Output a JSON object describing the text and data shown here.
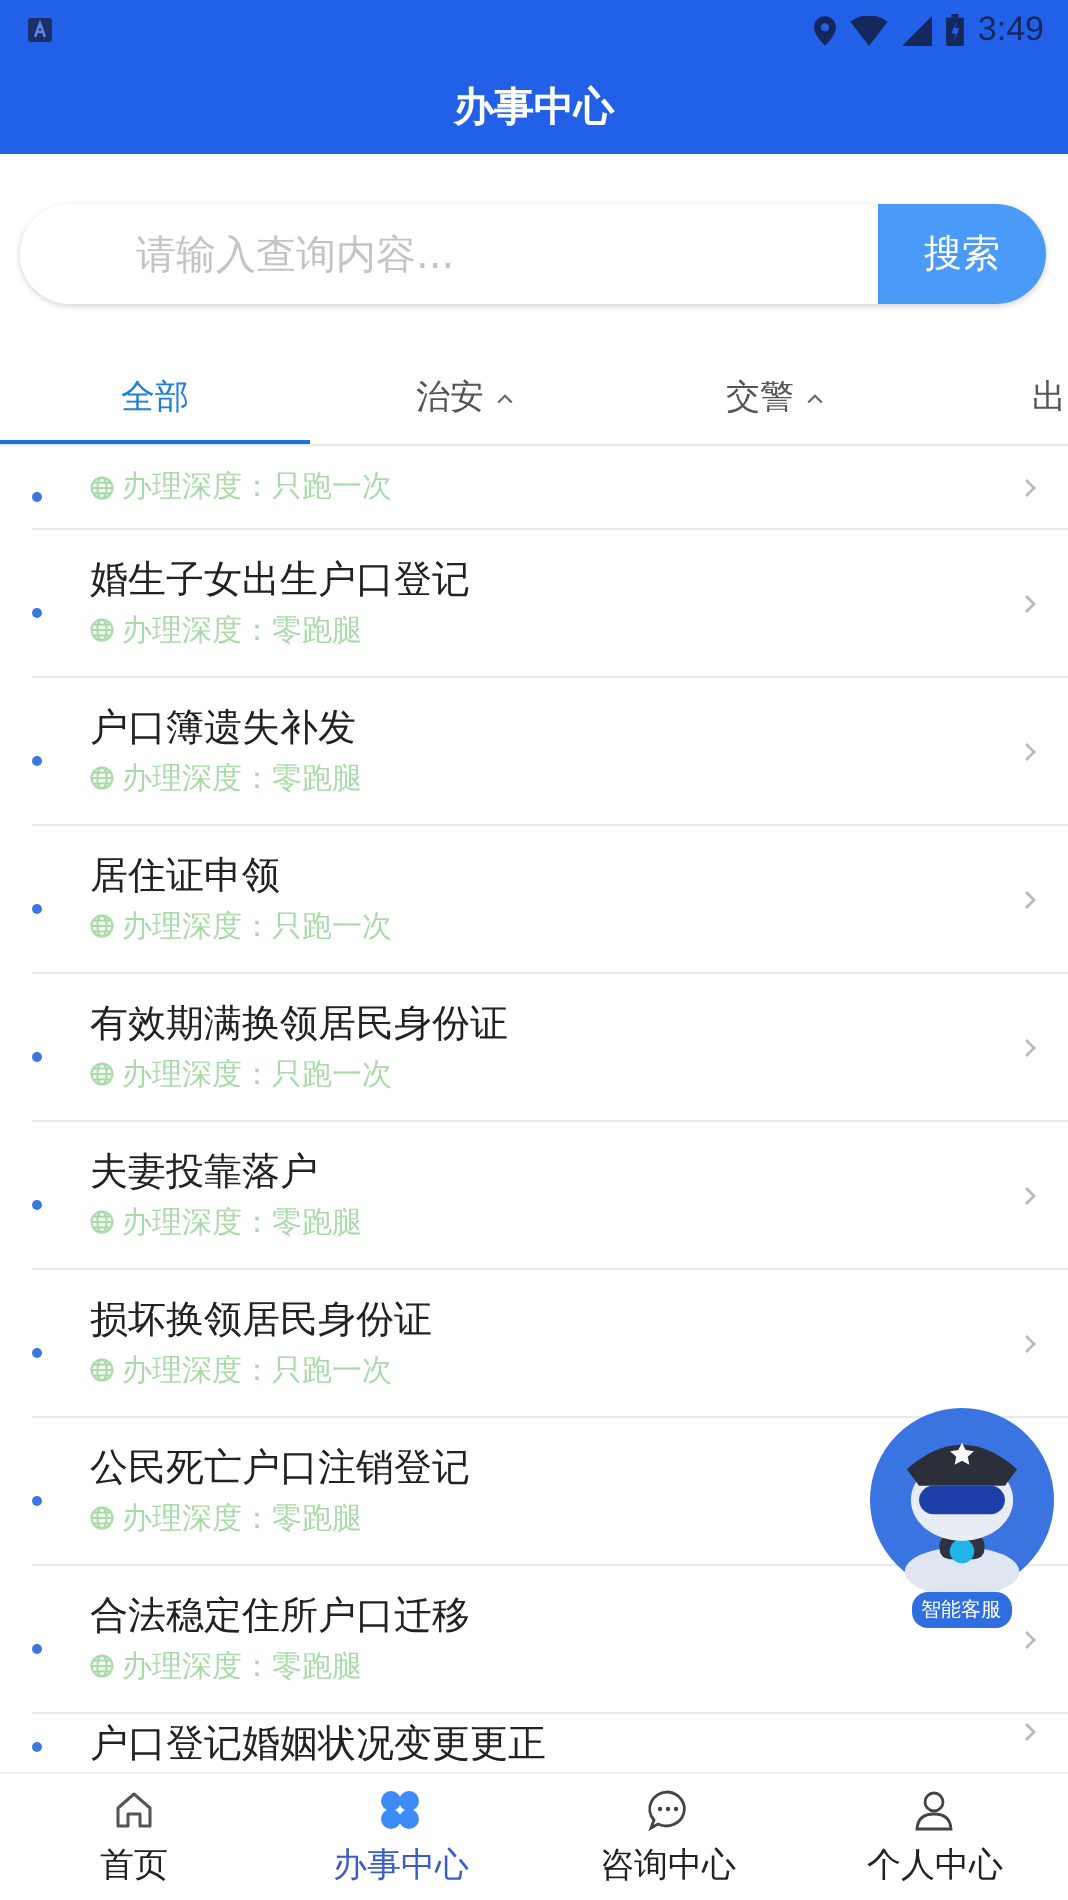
{
  "status_bar": {
    "time": "3:49"
  },
  "header": {
    "title": "办事中心"
  },
  "search": {
    "placeholder": "请输入查询内容...",
    "button": "搜索"
  },
  "tabs": [
    {
      "label": "全部",
      "selected": true,
      "caret": false
    },
    {
      "label": "治安",
      "selected": false,
      "caret": true
    },
    {
      "label": "交警",
      "selected": false,
      "caret": true
    },
    {
      "label": "出",
      "selected": false,
      "caret": false
    }
  ],
  "items": [
    {
      "depth": "办理深度：只跑一次"
    },
    {
      "title": "婚生子女出生户口登记",
      "depth": "办理深度：零跑腿"
    },
    {
      "title": "户口簿遗失补发",
      "depth": "办理深度：零跑腿"
    },
    {
      "title": "居住证申领",
      "depth": "办理深度：只跑一次"
    },
    {
      "title": "有效期满换领居民身份证",
      "depth": "办理深度：只跑一次"
    },
    {
      "title": "夫妻投靠落户",
      "depth": "办理深度：零跑腿"
    },
    {
      "title": "损坏换领居民身份证",
      "depth": "办理深度：只跑一次"
    },
    {
      "title": "公民死亡户口注销登记",
      "depth": "办理深度：零跑腿"
    },
    {
      "title": "合法稳定住所户口迁移",
      "depth": "办理深度：零跑腿"
    },
    {
      "title": "户口登记婚姻状况变更更正"
    }
  ],
  "assistant": {
    "label": "智能客服"
  },
  "bottom_nav": [
    {
      "label": "首页",
      "selected": false
    },
    {
      "label": "办事中心",
      "selected": true
    },
    {
      "label": "咨询中心",
      "selected": false
    },
    {
      "label": "个人中心",
      "selected": false
    }
  ]
}
